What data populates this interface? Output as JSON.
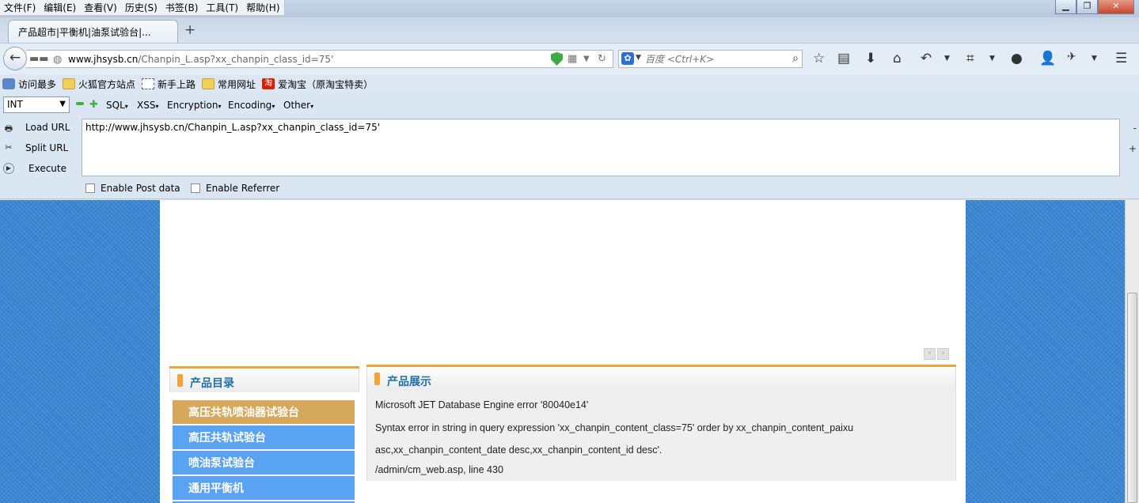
{
  "menubar": {
    "items": [
      "文件(F)",
      "编辑(E)",
      "查看(V)",
      "历史(S)",
      "书签(B)",
      "工具(T)",
      "帮助(H)"
    ]
  },
  "tab": {
    "title": "产品超市|平衡机|油泵试验台|..."
  },
  "nav": {
    "url_host": "www.jhsysb.cn",
    "url_path": "/Chanpin_L.asp?xx_chanpin_class_id=75'",
    "search_placeholder": "百度 <Ctrl+K>"
  },
  "bookmarks": [
    {
      "label": "访问最多",
      "icon": "clip"
    },
    {
      "label": "火狐官方站点",
      "icon": "folder"
    },
    {
      "label": "新手上路",
      "icon": "dotted"
    },
    {
      "label": "常用网址",
      "icon": "folder"
    },
    {
      "label": "爱淘宝（原淘宝特卖）",
      "icon": "tao",
      "badge": "淘"
    }
  ],
  "hackbar": {
    "select_value": "INT",
    "menus": [
      "SQL",
      "XSS",
      "Encryption",
      "Encoding",
      "Other"
    ],
    "load_url": "Load URL",
    "split_url": "Split URL",
    "execute": "Execute",
    "url_text": "http://www.jhsysb.cn/Chanpin_L.asp?xx_chanpin_class_id=75'",
    "enable_post": "Enable Post data",
    "enable_referrer": "Enable Referrer",
    "side_minus": "-",
    "side_plus": "+"
  },
  "page": {
    "left_box_title": "产品目录",
    "categories": [
      "高压共轨喷油器试验台",
      "高压共轨试验台",
      "喷油泵试验台",
      "通用平衡机"
    ],
    "right_box_title": "产品展示",
    "error_lines": [
      "Microsoft JET Database Engine  error '80040e14'",
      "Syntax error in string in query expression 'xx_chanpin_content_class=75' order by xx_chanpin_content_paixu",
      "asc,xx_chanpin_content_date desc,xx_chanpin_content_id desc'.",
      "/admin/cm_web.asp, line 430"
    ]
  },
  "colors": {
    "accent_orange": "#f4a23a",
    "category_blue": "#5aa2f2",
    "category_active": "#d6a85b",
    "page_background": "#3a86d3"
  }
}
